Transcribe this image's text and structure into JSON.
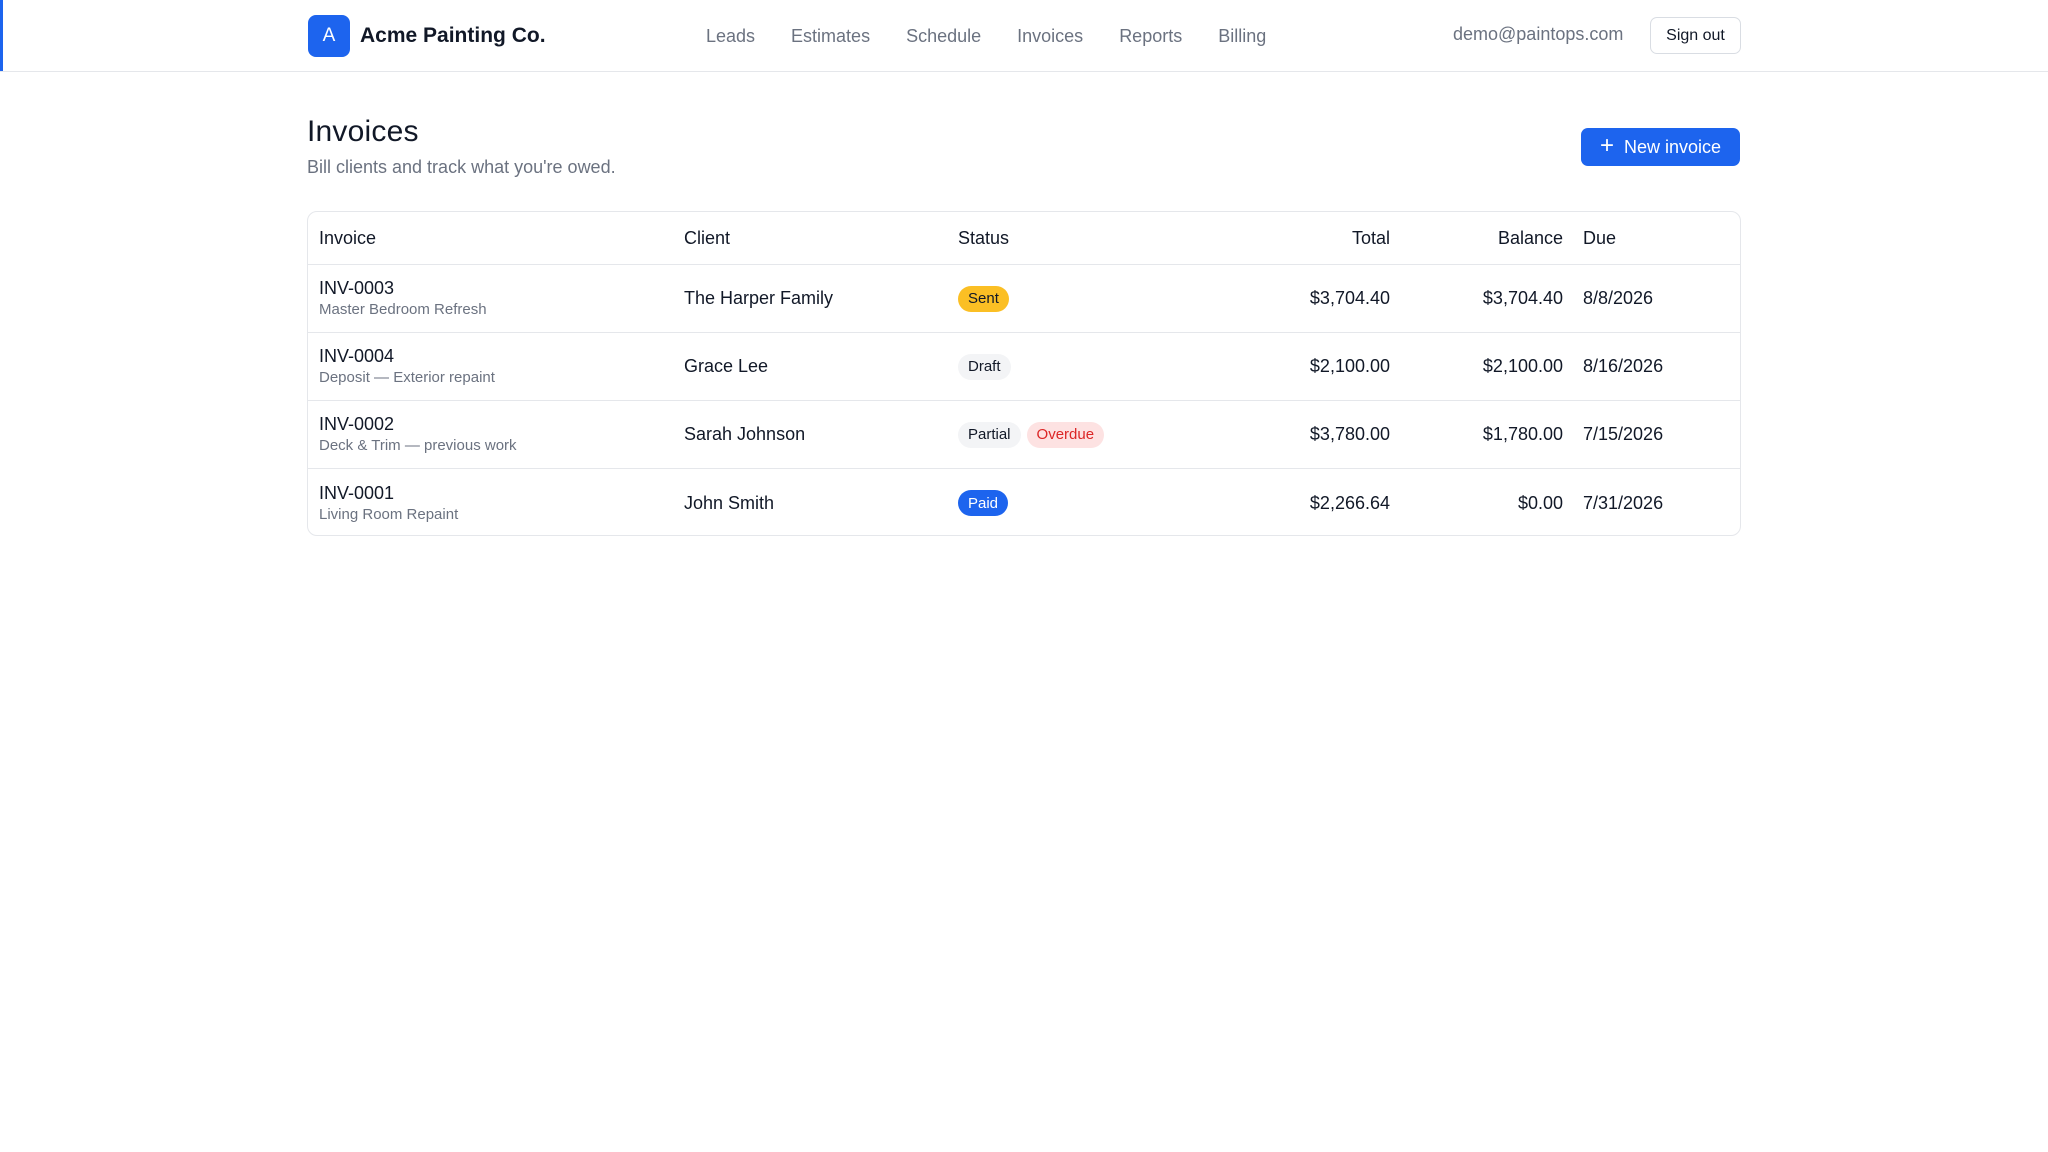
{
  "header": {
    "logo_letter": "A",
    "brand_name": "Acme Painting Co.",
    "nav": [
      "Leads",
      "Estimates",
      "Schedule",
      "Invoices",
      "Reports",
      "Billing"
    ],
    "user_email": "demo@paintops.com",
    "sign_out_label": "Sign out"
  },
  "page": {
    "title": "Invoices",
    "subtitle": "Bill clients and track what you're owed.",
    "new_button_label": "New invoice",
    "new_button_icon": "plus-icon"
  },
  "table": {
    "columns": {
      "invoice": "Invoice",
      "client": "Client",
      "status": "Status",
      "total": "Total",
      "balance": "Balance",
      "due": "Due"
    },
    "rows": [
      {
        "number": "INV-0003",
        "description": "Master Bedroom Refresh",
        "client": "The Harper Family",
        "badges": [
          {
            "label": "Sent",
            "kind": "sent"
          }
        ],
        "total": "$3,704.40",
        "balance": "$3,704.40",
        "due": "8/8/2026"
      },
      {
        "number": "INV-0004",
        "description": "Deposit — Exterior repaint",
        "client": "Grace Lee",
        "badges": [
          {
            "label": "Draft",
            "kind": "draft"
          }
        ],
        "total": "$2,100.00",
        "balance": "$2,100.00",
        "due": "8/16/2026"
      },
      {
        "number": "INV-0002",
        "description": "Deck & Trim — previous work",
        "client": "Sarah Johnson",
        "badges": [
          {
            "label": "Partial",
            "kind": "partial"
          },
          {
            "label": "Overdue",
            "kind": "overdue"
          }
        ],
        "total": "$3,780.00",
        "balance": "$1,780.00",
        "due": "7/15/2026"
      },
      {
        "number": "INV-0001",
        "description": "Living Room Repaint",
        "client": "John Smith",
        "badges": [
          {
            "label": "Paid",
            "kind": "paid"
          }
        ],
        "total": "$2,266.64",
        "balance": "$0.00",
        "due": "7/31/2026"
      }
    ]
  },
  "colors": {
    "accent": "#1d64ee",
    "sent": "#fbbf24",
    "overdue_text": "#dc2626",
    "overdue_bg": "#fde2e2",
    "muted_text": "#6b7280"
  }
}
